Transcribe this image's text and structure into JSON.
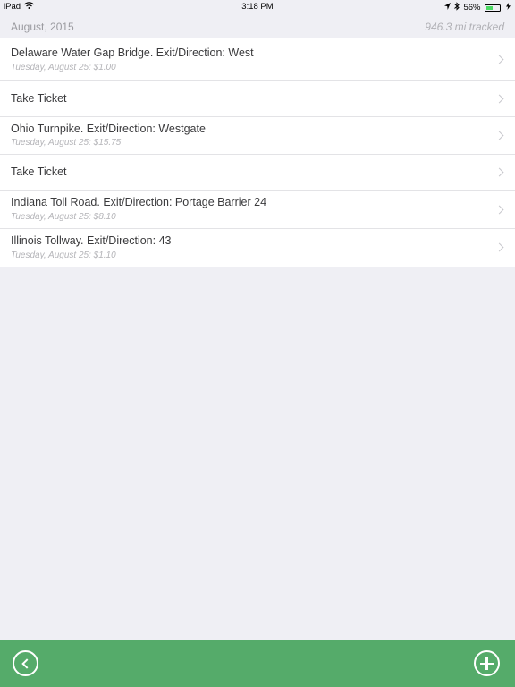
{
  "status_bar": {
    "device": "iPad",
    "time": "3:18 PM",
    "battery": "56%",
    "battery_level": 0.56,
    "icons": [
      "wifi-icon",
      "location-arrow-icon",
      "bluetooth-icon",
      "battery-icon"
    ]
  },
  "section": {
    "title": "August, 2015",
    "total": "946.3 mi tracked"
  },
  "rows": [
    {
      "title": "Delaware Water Gap Bridge. Exit/Direction: West",
      "subtitle": "Tuesday, August 25: $1.00"
    },
    {
      "title": "Take Ticket",
      "subtitle": ""
    },
    {
      "title": "Ohio Turnpike. Exit/Direction: Westgate",
      "subtitle": "Tuesday, August 25: $15.75"
    },
    {
      "title": "Take Ticket",
      "subtitle": ""
    },
    {
      "title": "Indiana Toll Road. Exit/Direction: Portage Barrier 24",
      "subtitle": "Tuesday, August 25: $8.10"
    },
    {
      "title": "Illinois Tollway. Exit/Direction: 43",
      "subtitle": "Tuesday, August 25: $1.10"
    }
  ],
  "toolbar": {
    "back_icon": "back-circle-icon",
    "add_icon": "add-circle-icon"
  },
  "colors": {
    "toolbar": "#55ab6a",
    "background": "#efeff4",
    "battery": "#4cd964"
  }
}
